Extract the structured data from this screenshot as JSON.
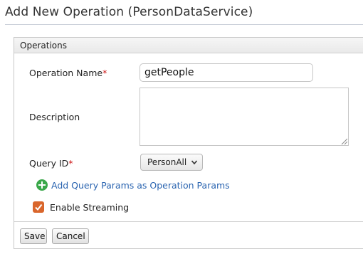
{
  "page": {
    "title": "Add New Operation (PersonDataService)"
  },
  "panel": {
    "header": "Operations",
    "operation_name": {
      "label": "Operation Name",
      "required_mark": "*",
      "value": "getPeople"
    },
    "description": {
      "label": "Description",
      "value": ""
    },
    "query_id": {
      "label": "Query ID",
      "required_mark": "*",
      "selected": "PersonAll"
    },
    "add_query_params_link": "Add Query Params as Operation Params",
    "enable_streaming": {
      "label": "Enable Streaming",
      "checked": true
    },
    "buttons": {
      "save": "Save",
      "cancel": "Cancel"
    }
  },
  "colors": {
    "link": "#2a64b0",
    "required": "#cc1111",
    "add_icon": "#3aa84a",
    "checkbox": "#d9662c"
  },
  "icons": [
    "add-icon",
    "checkbox-checked-icon",
    "chevron-down-icon",
    "resize-grip-icon"
  ]
}
